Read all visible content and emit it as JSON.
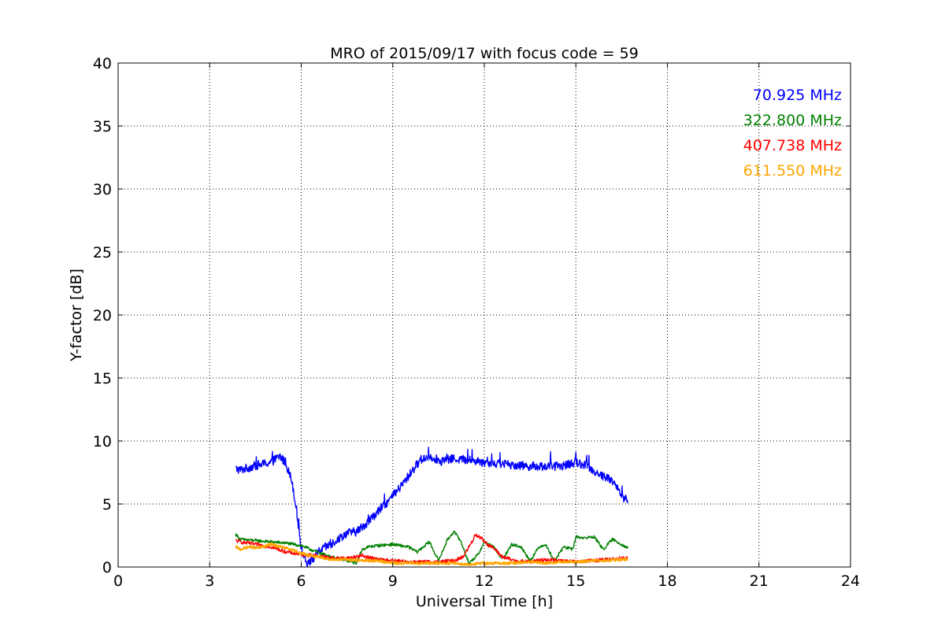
{
  "chart_data": {
    "type": "line",
    "title": "MRO of 2015/09/17 with focus code = 59",
    "xlabel": "Universal Time [h]",
    "ylabel": "Y-factor [dB]",
    "xlim": [
      0,
      24
    ],
    "ylim": [
      0,
      40
    ],
    "xticks": [
      0,
      3,
      6,
      9,
      12,
      15,
      18,
      21,
      24
    ],
    "yticks": [
      0,
      5,
      10,
      15,
      20,
      25,
      30,
      35,
      40
    ],
    "xtick_labels": [
      "0",
      "3",
      "6",
      "9",
      "12",
      "15",
      "18",
      "21",
      "24"
    ],
    "ytick_labels": [
      "0",
      "5",
      "10",
      "15",
      "20",
      "25",
      "30",
      "35",
      "40"
    ],
    "grid": true,
    "legend_position": "top-right",
    "series": [
      {
        "name": "70.925 MHz",
        "color": "#0000ff",
        "noise": 0.35,
        "x": [
          3.85,
          4.0,
          4.3,
          4.6,
          5.0,
          5.3,
          5.5,
          5.7,
          5.85,
          6.0,
          6.2,
          6.4,
          6.6,
          6.9,
          7.2,
          7.5,
          7.8,
          8.2,
          8.6,
          9.0,
          9.3,
          9.6,
          9.9,
          10.2,
          10.6,
          11.0,
          11.5,
          12.0,
          12.5,
          13.0,
          13.5,
          14.0,
          14.5,
          15.0,
          15.3,
          15.6,
          15.9,
          16.1,
          16.25,
          16.4,
          16.6,
          16.7
        ],
        "y": [
          7.8,
          7.7,
          7.9,
          8.1,
          8.3,
          8.8,
          8.2,
          6.8,
          4.5,
          1.5,
          0.3,
          0.7,
          1.3,
          1.7,
          2.2,
          2.7,
          2.8,
          3.6,
          4.6,
          5.6,
          6.5,
          7.5,
          8.5,
          8.8,
          8.4,
          8.6,
          8.5,
          8.3,
          8.2,
          8.1,
          8.0,
          8.0,
          8.0,
          8.3,
          8.1,
          7.6,
          7.2,
          7.0,
          6.8,
          6.0,
          5.4,
          5.3
        ]
      },
      {
        "name": "322.800 MHz",
        "color": "#008000",
        "noise": 0.12,
        "x": [
          3.85,
          4.0,
          4.5,
          5.0,
          5.5,
          6.0,
          6.5,
          7.0,
          7.5,
          7.8,
          8.0,
          8.2,
          8.5,
          9.0,
          9.5,
          9.8,
          10.2,
          10.5,
          10.8,
          11.0,
          11.2,
          11.5,
          11.8,
          12.0,
          12.3,
          12.6,
          12.9,
          13.2,
          13.5,
          13.8,
          14.0,
          14.3,
          14.6,
          14.9,
          15.0,
          15.3,
          15.6,
          15.9,
          16.2,
          16.5,
          16.7
        ],
        "y": [
          2.6,
          2.2,
          2.1,
          2.0,
          1.9,
          1.7,
          1.2,
          0.8,
          0.5,
          0.3,
          1.4,
          1.6,
          1.7,
          1.8,
          1.6,
          1.2,
          2.0,
          0.5,
          2.2,
          2.8,
          2.2,
          0.3,
          1.0,
          2.0,
          1.6,
          0.6,
          1.8,
          1.6,
          0.5,
          1.6,
          1.8,
          0.5,
          1.6,
          1.4,
          2.4,
          2.3,
          2.4,
          1.4,
          2.2,
          1.8,
          1.5
        ]
      },
      {
        "name": "407.738 MHz",
        "color": "#ff0000",
        "noise": 0.15,
        "x": [
          3.85,
          4.0,
          4.5,
          5.0,
          5.5,
          6.0,
          6.5,
          7.0,
          7.5,
          8.0,
          8.5,
          9.0,
          9.5,
          10.0,
          10.5,
          11.0,
          11.3,
          11.6,
          11.7,
          11.9,
          12.1,
          12.3,
          12.6,
          13.0,
          13.5,
          14.0,
          14.5,
          15.0,
          15.5,
          16.0,
          16.5,
          16.7
        ],
        "y": [
          2.1,
          2.0,
          1.8,
          1.6,
          1.2,
          1.0,
          0.9,
          0.7,
          0.7,
          0.9,
          0.6,
          0.5,
          0.4,
          0.4,
          0.4,
          0.5,
          0.8,
          2.0,
          2.6,
          2.3,
          1.8,
          1.5,
          0.8,
          0.5,
          0.4,
          0.6,
          0.5,
          0.4,
          0.5,
          0.6,
          0.7,
          0.7
        ]
      },
      {
        "name": "611.550 MHz",
        "color": "#ffa500",
        "noise": 0.1,
        "x": [
          3.85,
          4.0,
          4.3,
          4.6,
          5.0,
          5.5,
          6.0,
          6.5,
          7.0,
          7.5,
          8.0,
          8.5,
          9.0,
          9.5,
          10.0,
          10.5,
          11.0,
          11.5,
          12.0,
          12.5,
          13.0,
          13.5,
          14.0,
          14.5,
          15.0,
          15.5,
          16.0,
          16.5,
          16.7
        ],
        "y": [
          1.6,
          1.4,
          1.6,
          1.5,
          1.8,
          1.5,
          1.1,
          0.8,
          0.6,
          0.6,
          0.5,
          0.5,
          0.3,
          0.3,
          0.3,
          0.3,
          0.3,
          0.2,
          0.3,
          0.3,
          0.3,
          0.4,
          0.3,
          0.4,
          0.4,
          0.5,
          0.5,
          0.6,
          0.6
        ]
      }
    ]
  }
}
